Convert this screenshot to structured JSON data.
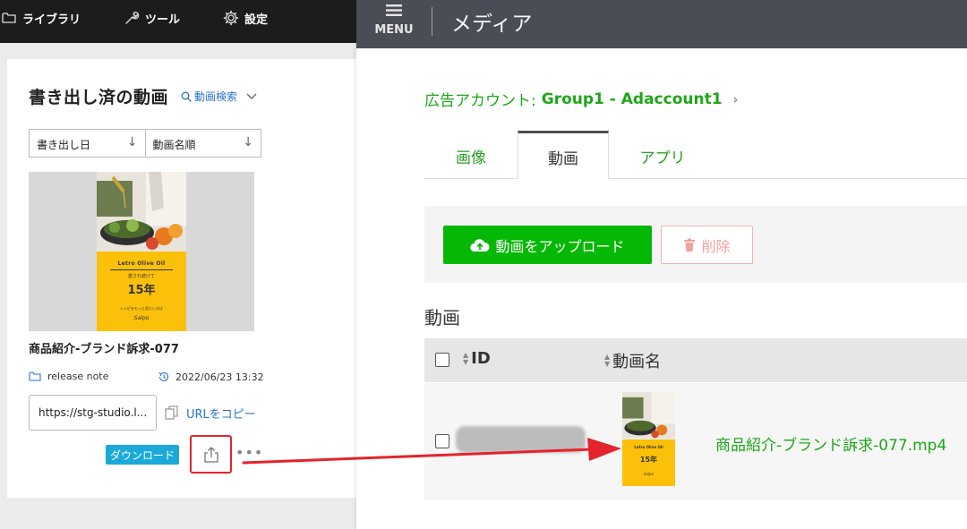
{
  "left_app": {
    "nav": {
      "library": "ライブラリ",
      "tools": "ツール",
      "settings": "設定"
    },
    "panel": {
      "title": "書き出し済の動画",
      "search_label": "動画検索",
      "sort": {
        "by_date": "書き出し日",
        "by_name": "動画名順"
      },
      "video": {
        "title": "商品紹介-ブランド訴求-077",
        "poster": {
          "brand": "Letro Olive Oil",
          "tagline": "愛され続けて",
          "years": "15年",
          "footer": "レシピをもっと見たい方は",
          "signature": "Salpo"
        },
        "folder": "release note",
        "exported_at": "2022/06/23 13:32",
        "url_value": "https://stg-studio.l...",
        "copy_url_label": "URLをコピー",
        "download_label": "ダウンロード",
        "more_label": "•••"
      }
    }
  },
  "right_app": {
    "header": {
      "menu_label": "MENU",
      "title": "メディア"
    },
    "breadcrumb": {
      "prefix": "広告アカウント:",
      "account": "Group1 - Adaccount1",
      "chevron": "›"
    },
    "tabs": [
      {
        "label": "画像",
        "active": false
      },
      {
        "label": "動画",
        "active": true
      },
      {
        "label": "アプリ",
        "active": false
      }
    ],
    "actions": {
      "upload_label": "動画をアップロード",
      "delete_label": "削除"
    },
    "section_title": "動画",
    "table": {
      "columns": [
        "ID",
        "動画名"
      ],
      "rows": [
        {
          "id": "",
          "name": "商品紹介-ブランド訴求-077.mp4",
          "poster": {
            "brand": "Letro Olive Oil",
            "years": "15年",
            "signature": "Salpo"
          }
        }
      ]
    }
  },
  "colors": {
    "accent_green": "#06b806",
    "link_green": "#1ea61a",
    "link_blue": "#2a73c9",
    "download_blue": "#1baad8",
    "annotation_red": "#e4232c",
    "poster_yellow": "#fbc10a",
    "header_gray": "#4a4d55",
    "topbar_black": "#1c1c1c"
  }
}
